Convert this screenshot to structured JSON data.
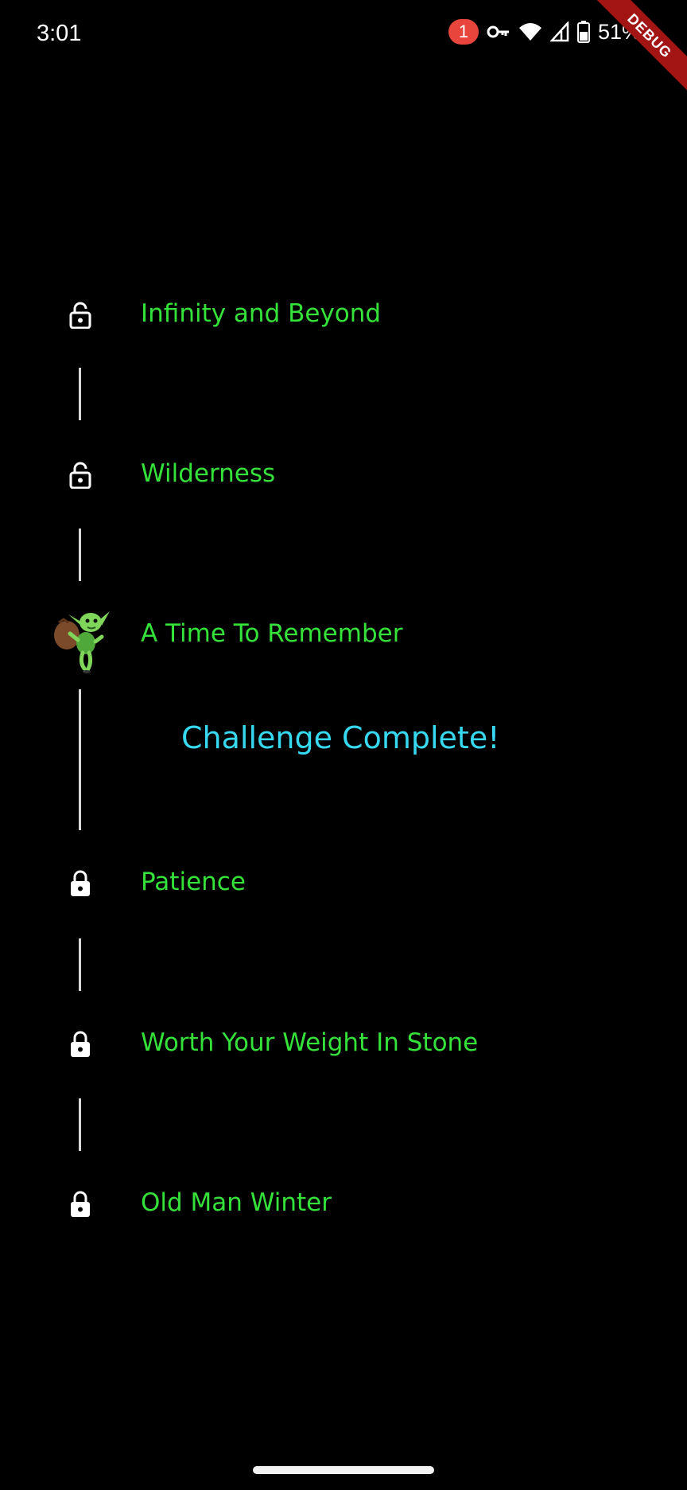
{
  "status_bar": {
    "time": "3:01",
    "notification_count": "1",
    "battery_percent": "51%",
    "icons": [
      "notification-badge",
      "vpn-key-icon",
      "wifi-icon",
      "cell-signal-icon",
      "battery-icon"
    ]
  },
  "debug_banner": {
    "label": "DEBUG"
  },
  "levels": [
    {
      "title": "Infinity and Beyond",
      "status": "unlocked",
      "icon": "lock-open-icon"
    },
    {
      "title": "Wilderness",
      "status": "unlocked",
      "icon": "lock-open-icon"
    },
    {
      "title": "A Time To Remember",
      "status": "current",
      "icon": "goblin-character-icon"
    },
    {
      "title": "Patience",
      "status": "locked",
      "icon": "lock-icon"
    },
    {
      "title": "Worth Your Weight In Stone",
      "status": "locked",
      "icon": "lock-icon"
    },
    {
      "title": "Old Man Winter",
      "status": "locked",
      "icon": "lock-icon"
    }
  ],
  "challenge": {
    "message": "Challenge Complete!"
  },
  "colors": {
    "background": "#000000",
    "level_title": "#35e23a",
    "challenge_text": "#37d9f0",
    "connector": "#d9d9d9",
    "debug_ribbon": "#a31515",
    "badge": "#e8453c"
  }
}
